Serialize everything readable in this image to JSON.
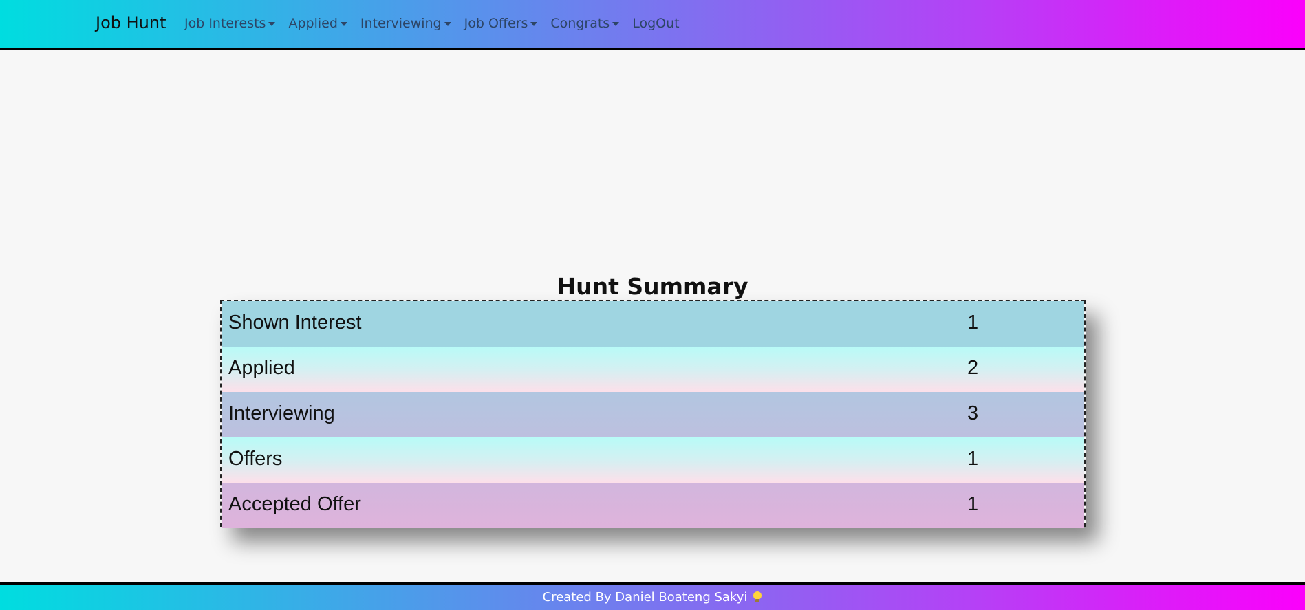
{
  "navbar": {
    "brand": "Job Hunt",
    "items": [
      {
        "label": "Job Interests",
        "dropdown": true
      },
      {
        "label": "Applied",
        "dropdown": true
      },
      {
        "label": "Interviewing",
        "dropdown": true
      },
      {
        "label": "Job Offers",
        "dropdown": true
      },
      {
        "label": "Congrats",
        "dropdown": true
      },
      {
        "label": "LogOut",
        "dropdown": false
      }
    ]
  },
  "summary": {
    "title": "Hunt Summary",
    "rows": [
      {
        "label": "Shown Interest",
        "count": "1"
      },
      {
        "label": "Applied",
        "count": "2"
      },
      {
        "label": "Interviewing",
        "count": "3"
      },
      {
        "label": "Offers",
        "count": "1"
      },
      {
        "label": "Accepted Offer",
        "count": "1"
      }
    ]
  },
  "footer": {
    "text": "Created By Daniel Boateng Sakyi",
    "icon": "lightbulb-icon"
  },
  "colors": {
    "gradient_start": "#00dde0",
    "gradient_end": "#fb00fb",
    "background": "#f7f7f7"
  }
}
